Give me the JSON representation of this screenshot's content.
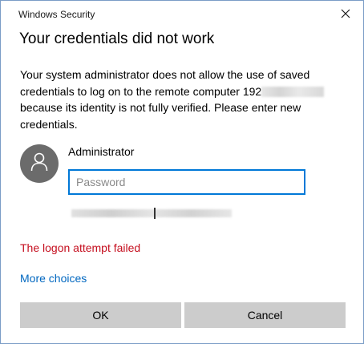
{
  "window": {
    "title": "Windows Security"
  },
  "heading": "Your credentials did not work",
  "message": {
    "before_redaction": "Your system administrator does not allow the use of saved credentials to log on to the remote computer 192",
    "after_redaction": " because its identity is not fully verified. Please enter new credentials."
  },
  "account": {
    "username": "Administrator",
    "avatar_icon": "user-icon"
  },
  "password": {
    "value": "",
    "placeholder": "Password"
  },
  "status": {
    "error": "The logon attempt failed",
    "error_color": "#c50f1f"
  },
  "links": {
    "more_choices": "More choices"
  },
  "buttons": {
    "ok": "OK",
    "cancel": "Cancel"
  },
  "colors": {
    "accent": "#0078d7",
    "link": "#0067c0",
    "button_bg": "#cccccc",
    "avatar_bg": "#6b6b6b"
  }
}
